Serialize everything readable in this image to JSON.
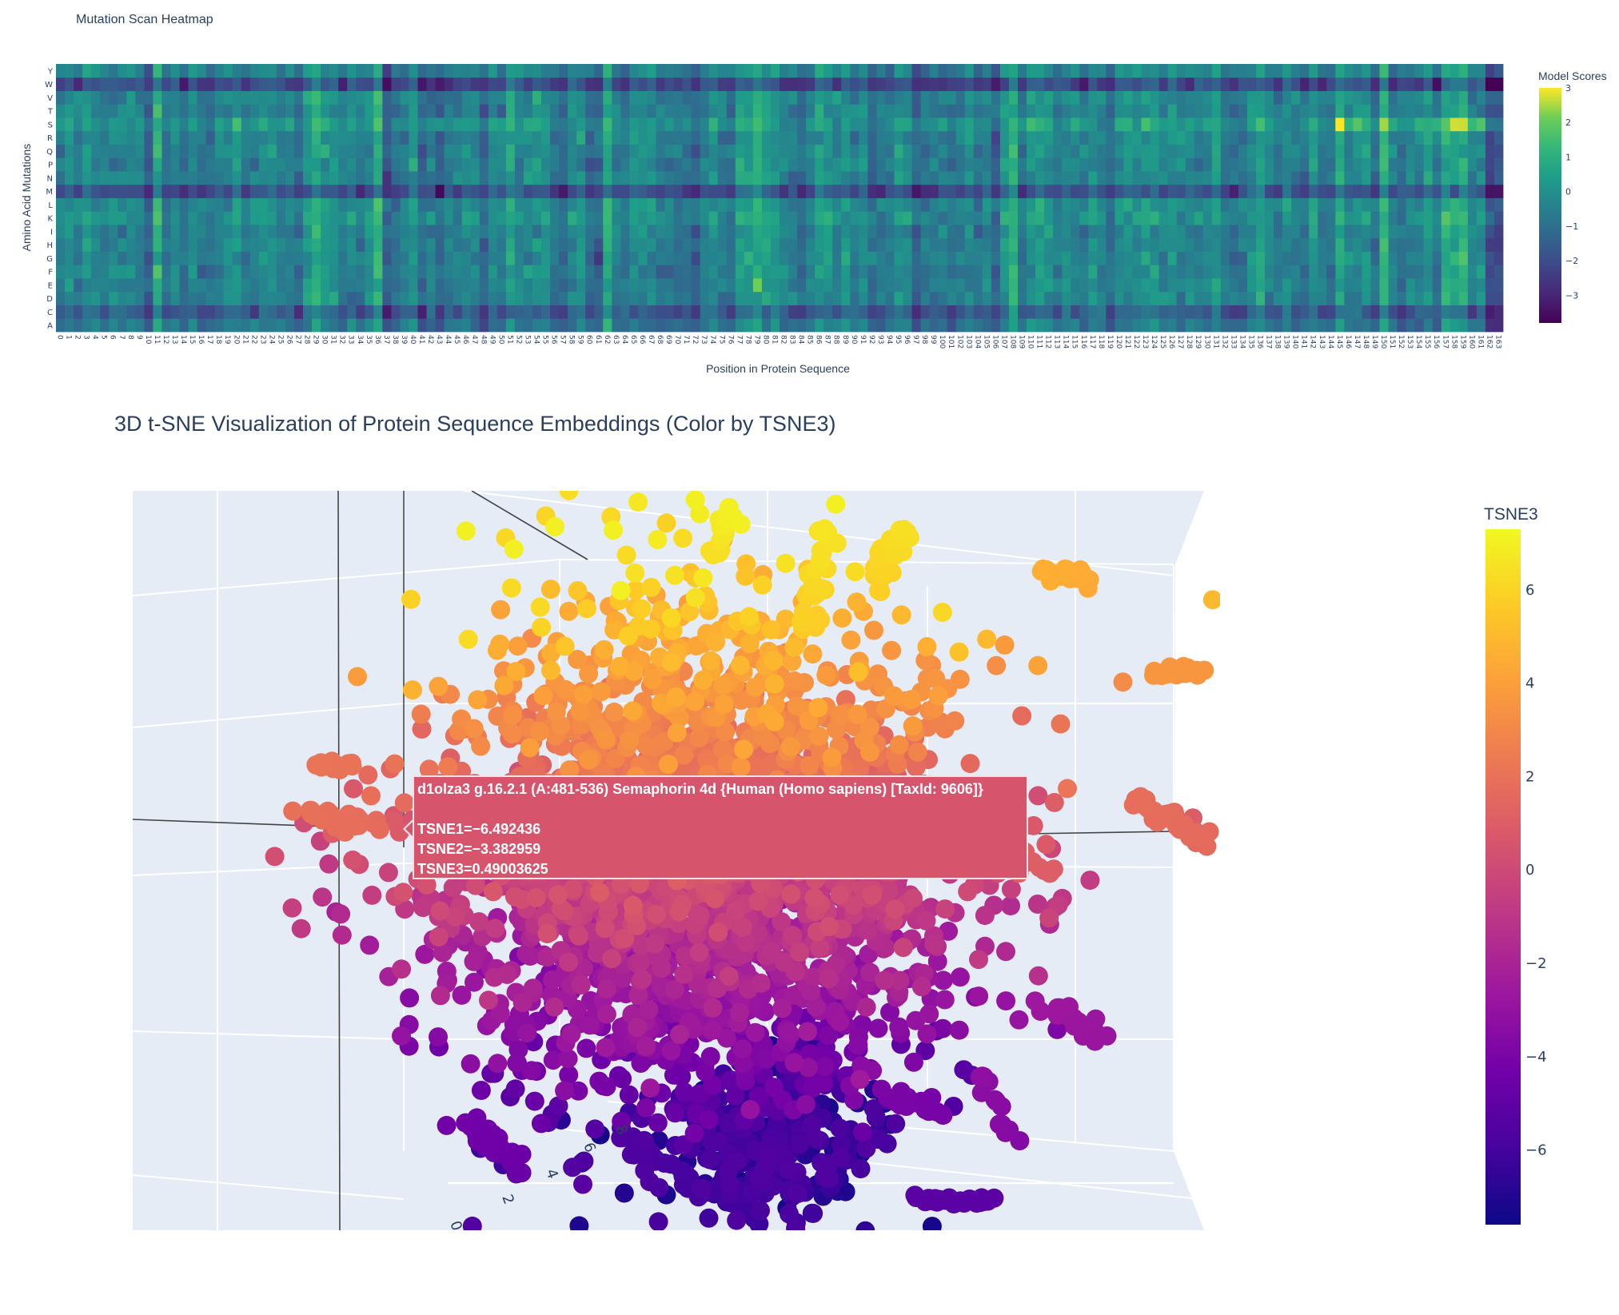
{
  "chart_data": [
    {
      "type": "heatmap",
      "title": "Mutation Scan Heatmap",
      "xlabel": "Position in Protein Sequence",
      "ylabel": "Amino Acid Mutations",
      "x_range": [
        0,
        163
      ],
      "y_categories": [
        "A",
        "C",
        "D",
        "E",
        "F",
        "G",
        "H",
        "I",
        "K",
        "L",
        "M",
        "N",
        "P",
        "Q",
        "R",
        "S",
        "T",
        "V",
        "W",
        "Y"
      ],
      "colorbar": {
        "title": "Model Scores",
        "ticks": [
          3,
          2,
          1,
          0,
          -1,
          -2,
          -3
        ],
        "range": [
          -3.8,
          3
        ]
      },
      "colorscale": "viridis"
    },
    {
      "type": "scatter",
      "title": "3D t-SNE Visualization of Protein Sequence Embeddings (Color by TSNE3)",
      "colorbar": {
        "title": "TSNE3",
        "ticks": [
          6,
          4,
          2,
          0,
          -2,
          -4,
          -6
        ],
        "range": [
          -7.6,
          7.3
        ]
      },
      "colorscale": "plasma",
      "axis_tick_labels": [
        "8",
        "6",
        "4",
        "2",
        "0"
      ],
      "hover": {
        "label": "d1olza3 g.16.2.1 (A:481-536) Semaphorin 4d {Human (Homo sapiens) [TaxId: 9606]}",
        "tsne1": "TSNE1=−6.492436",
        "tsne2": "TSNE2=−3.382959",
        "tsne3": "TSNE3=0.49003625"
      },
      "background": "#e5ecf6"
    }
  ]
}
